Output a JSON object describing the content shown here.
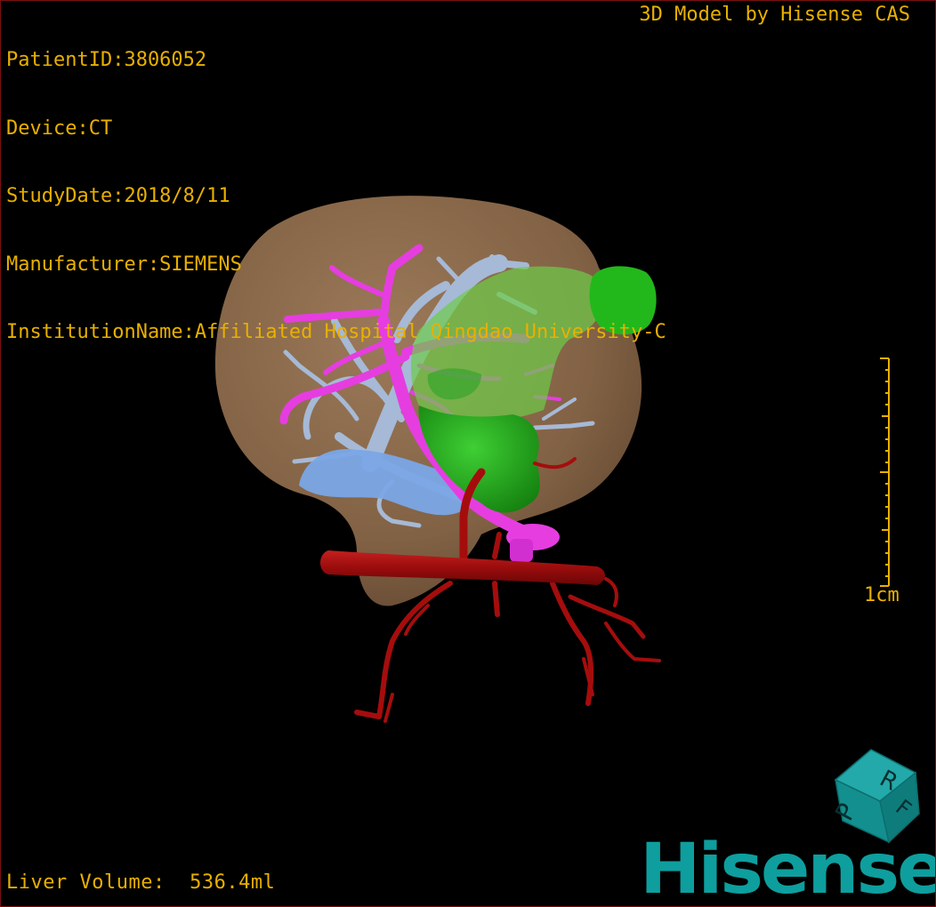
{
  "patient_info": {
    "patient_id": "PatientID:3806052",
    "device": "Device:CT",
    "study_date": "StudyDate:2018/8/11",
    "manufacturer": "Manufacturer:SIEMENS",
    "institution": "InstitutionName:Affiliated Hospital Qingdao University-C"
  },
  "model_credit": "3D Model by Hisense CAS",
  "liver_volume": "Liver Volume:  536.4ml",
  "scale_bar": {
    "label": "1cm"
  },
  "orientation_cube": {
    "faces": [
      "P",
      "R",
      "F"
    ],
    "color": "#138f8f"
  },
  "brand": "Hisense",
  "colors": {
    "overlay_text": "#e8b000",
    "liver": "#8d6a4a",
    "hepatic_veins": "#a6b9d6",
    "portal_vein": "#e63de0",
    "artery": "#a50d0d",
    "tumor": "#1faa1a",
    "brand": "#0e9e9e",
    "border": "#7a1010"
  }
}
